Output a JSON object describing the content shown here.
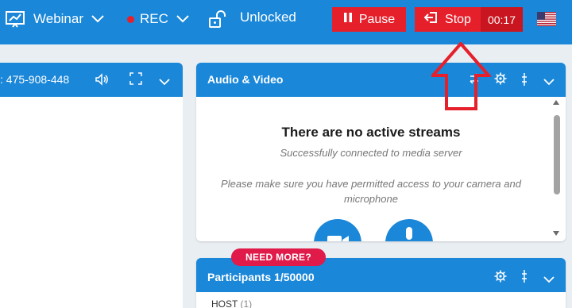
{
  "topbar": {
    "mode_label": "Webinar",
    "rec_label": "REC",
    "lock_label": "Unlocked",
    "pause_label": "Pause",
    "stop_label": "Stop",
    "timer": "00:17",
    "language_flag": "us-flag-icon"
  },
  "left_panel": {
    "meeting_id": ": 475-908-448"
  },
  "audio_video": {
    "title": "Audio & Video",
    "heading": "There are no active streams",
    "connected_text": "Successfully connected to media server",
    "permission_text": "Please make sure you have permitted access to your camera and microphone"
  },
  "participants": {
    "title": "Participants 1/50000",
    "host_label": "HOST",
    "host_count": "(1)",
    "need_more": "NEED MORE?"
  },
  "colors": {
    "primary": "#1a87d9",
    "danger": "#e5202b",
    "badge": "#e01a49",
    "annotation_arrow": "#e5202b"
  }
}
